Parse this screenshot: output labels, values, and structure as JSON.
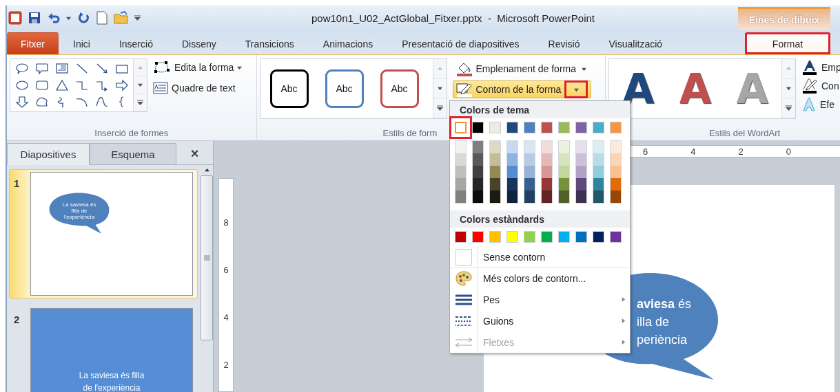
{
  "title_bar": {
    "document_title": "pow10n1_U02_ActGlobal_Fitxer.pptx  -  Microsoft PowerPoint",
    "contextual_tab_group": "Eines de dibuix"
  },
  "tabs": [
    {
      "label": "Fitxer",
      "kind": "file",
      "selected": false,
      "highlighted": false
    },
    {
      "label": "Inici",
      "kind": "normal",
      "selected": false,
      "highlighted": false
    },
    {
      "label": "Inserció",
      "kind": "normal",
      "selected": false,
      "highlighted": false
    },
    {
      "label": "Disseny",
      "kind": "normal",
      "selected": false,
      "highlighted": false
    },
    {
      "label": "Transicions",
      "kind": "normal",
      "selected": false,
      "highlighted": false
    },
    {
      "label": "Animacions",
      "kind": "normal",
      "selected": false,
      "highlighted": false
    },
    {
      "label": "Presentació de diapositives",
      "kind": "normal",
      "selected": false,
      "highlighted": false
    },
    {
      "label": "Revisió",
      "kind": "normal",
      "selected": false,
      "highlighted": false
    },
    {
      "label": "Visualització",
      "kind": "normal",
      "selected": false,
      "highlighted": false
    },
    {
      "label": "Format",
      "kind": "contextual",
      "selected": true,
      "highlighted": true
    }
  ],
  "shapes_group": {
    "label": "Inserció de formes",
    "commands": [
      {
        "label": "Edita la forma",
        "kind": "edit",
        "has_caret": true
      },
      {
        "label": "Quadre de text",
        "kind": "textbox",
        "has_caret": false
      }
    ]
  },
  "shape_styles_group": {
    "label": "Estils de form",
    "styles": [
      {
        "label": "Abc",
        "color": "#000000"
      },
      {
        "label": "Abc",
        "color": "#4f81bd"
      },
      {
        "label": "Abc",
        "color": "#c0504d"
      }
    ],
    "buttons": [
      {
        "label": "Emplenament de forma",
        "kind": "fill",
        "pressed": false,
        "caret_highlighted": false
      },
      {
        "label": "Contorn de la forma",
        "kind": "outline",
        "pressed": true,
        "caret_highlighted": true
      }
    ]
  },
  "wordart_group": {
    "label": "Estils del WordArt",
    "styles": [
      {
        "label": "A",
        "color": "#1f497d"
      },
      {
        "label": "A",
        "color": "#c0504d"
      },
      {
        "label": "A",
        "color": "#a6a6a6"
      }
    ],
    "commands": [
      {
        "label": "Emp",
        "kind": "fill"
      },
      {
        "label": "Con",
        "kind": "outline"
      },
      {
        "label": "Efe",
        "kind": "effects"
      }
    ]
  },
  "slides_pane": {
    "tabs": [
      {
        "label": "Diapositives",
        "selected": true
      },
      {
        "label": "Esquema",
        "selected": false
      }
    ],
    "close": "×",
    "slides": [
      {
        "number": "1",
        "kind": "bubble",
        "selected": true,
        "lines": [
          "La saviesa és",
          "filla de",
          "l'experiència"
        ]
      },
      {
        "number": "2",
        "kind": "blue",
        "selected": false,
        "lines": [
          "La saviesa és filla",
          "de l'experiència"
        ]
      }
    ]
  },
  "rulers": {
    "horizontal": [
      "6",
      "4",
      "2",
      "0"
    ],
    "vertical": [
      "8",
      "6",
      "4",
      "2"
    ]
  },
  "slide": {
    "bubble_lines": [
      "**aviesa** és",
      "illa de",
      "periència"
    ]
  },
  "outline_menu": {
    "theme_heading": "Colors de tema",
    "standard_heading": "Colors estàndards",
    "theme_colors": [
      {
        "color": "#ffffff",
        "selected": true,
        "highlighted": true,
        "shades": [
          {
            "color": "#f2f2f2",
            "selected": false
          },
          {
            "color": "#d9d9d9",
            "selected": false
          },
          {
            "color": "#bfbfbf",
            "selected": false
          },
          {
            "color": "#a6a6a6",
            "selected": false
          },
          {
            "color": "#808080",
            "selected": false
          }
        ]
      },
      {
        "color": "#000000",
        "selected": false,
        "highlighted": false,
        "shades": [
          {
            "color": "#7f7f7f",
            "selected": false
          },
          {
            "color": "#595959",
            "selected": false
          },
          {
            "color": "#3f3f3f",
            "selected": false
          },
          {
            "color": "#262626",
            "selected": false
          },
          {
            "color": "#0d0d0d",
            "selected": false
          }
        ]
      },
      {
        "color": "#eeece1",
        "selected": false,
        "highlighted": false,
        "shades": [
          {
            "color": "#ddd9c3",
            "selected": false
          },
          {
            "color": "#c4bd97",
            "selected": false
          },
          {
            "color": "#938953",
            "selected": false
          },
          {
            "color": "#494429",
            "selected": false
          },
          {
            "color": "#1d1b10",
            "selected": false
          }
        ]
      },
      {
        "color": "#1f497d",
        "selected": false,
        "highlighted": false,
        "shades": [
          {
            "color": "#c6d9f0",
            "selected": false
          },
          {
            "color": "#8db3e2",
            "selected": false
          },
          {
            "color": "#548dd4",
            "selected": false
          },
          {
            "color": "#17365d",
            "selected": false
          },
          {
            "color": "#0f243e",
            "selected": false
          }
        ]
      },
      {
        "color": "#4f81bd",
        "selected": false,
        "highlighted": false,
        "shades": [
          {
            "color": "#dbe5f1",
            "selected": false
          },
          {
            "color": "#b8cce4",
            "selected": false
          },
          {
            "color": "#95b3d7",
            "selected": false
          },
          {
            "color": "#366092",
            "selected": false
          },
          {
            "color": "#244061",
            "selected": false
          }
        ]
      },
      {
        "color": "#c0504d",
        "selected": false,
        "highlighted": false,
        "shades": [
          {
            "color": "#f2dcdb",
            "selected": false
          },
          {
            "color": "#e5b9b7",
            "selected": false
          },
          {
            "color": "#d99694",
            "selected": false
          },
          {
            "color": "#953734",
            "selected": false
          },
          {
            "color": "#632423",
            "selected": false
          }
        ]
      },
      {
        "color": "#9bbb59",
        "selected": false,
        "highlighted": false,
        "shades": [
          {
            "color": "#ebf1dd",
            "selected": false
          },
          {
            "color": "#d7e3bc",
            "selected": false
          },
          {
            "color": "#c3d69b",
            "selected": false
          },
          {
            "color": "#76923c",
            "selected": false
          },
          {
            "color": "#4f6128",
            "selected": false
          }
        ]
      },
      {
        "color": "#8064a2",
        "selected": false,
        "highlighted": false,
        "shades": [
          {
            "color": "#e5e0ec",
            "selected": false
          },
          {
            "color": "#ccc1d9",
            "selected": false
          },
          {
            "color": "#b2a2c7",
            "selected": false
          },
          {
            "color": "#5f497a",
            "selected": false
          },
          {
            "color": "#3f3151",
            "selected": false
          }
        ]
      },
      {
        "color": "#4bacc6",
        "selected": false,
        "highlighted": false,
        "shades": [
          {
            "color": "#dbeef3",
            "selected": false
          },
          {
            "color": "#b7dde8",
            "selected": false
          },
          {
            "color": "#92cddc",
            "selected": false
          },
          {
            "color": "#31859b",
            "selected": false
          },
          {
            "color": "#205867",
            "selected": false
          }
        ]
      },
      {
        "color": "#f79646",
        "selected": false,
        "highlighted": false,
        "shades": [
          {
            "color": "#fdeada",
            "selected": false
          },
          {
            "color": "#fbd5b5",
            "selected": false
          },
          {
            "color": "#fac08f",
            "selected": false
          },
          {
            "color": "#e36c09",
            "selected": false
          },
          {
            "color": "#974806",
            "selected": false
          }
        ]
      }
    ],
    "standard_colors": [
      {
        "color": "#c00000",
        "selected": false
      },
      {
        "color": "#ff0000",
        "selected": false
      },
      {
        "color": "#ffc000",
        "selected": false
      },
      {
        "color": "#ffff00",
        "selected": false
      },
      {
        "color": "#92d050",
        "selected": false
      },
      {
        "color": "#00b050",
        "selected": false
      },
      {
        "color": "#00b0f0",
        "selected": false
      },
      {
        "color": "#0070c0",
        "selected": false
      },
      {
        "color": "#002060",
        "selected": false
      },
      {
        "color": "#7030a0",
        "selected": false
      }
    ],
    "items": [
      {
        "label": "Sense contorn",
        "kind": "no-outline",
        "disabled": false,
        "submenu": false
      },
      {
        "label": "Més colors de contorn...",
        "kind": "more-colors",
        "disabled": false,
        "submenu": false
      },
      {
        "label": "Pes",
        "kind": "weight",
        "disabled": false,
        "submenu": true
      },
      {
        "label": "Guions",
        "kind": "dashes",
        "disabled": false,
        "submenu": true
      },
      {
        "label": "Fletxes",
        "kind": "arrows",
        "disabled": true,
        "submenu": true
      }
    ]
  }
}
